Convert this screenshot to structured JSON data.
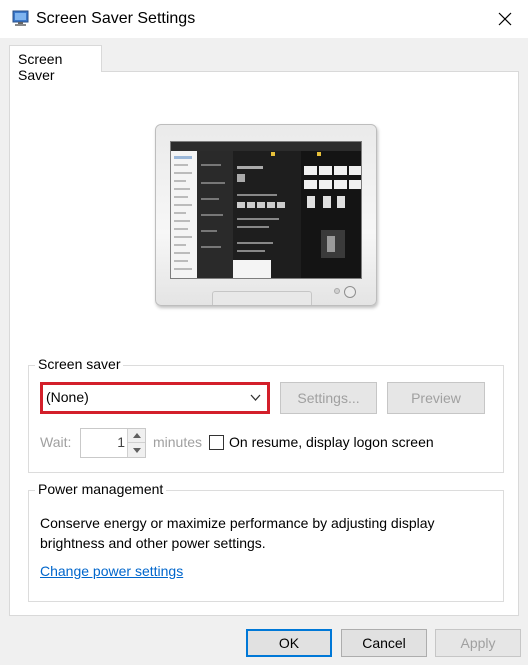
{
  "window": {
    "title": "Screen Saver Settings",
    "close_glyph": "✕",
    "icon": "screen-saver-app-icon"
  },
  "tabs": [
    {
      "label": "Screen Saver",
      "selected": true
    }
  ],
  "preview": {
    "icon": "monitor-preview"
  },
  "screen_saver": {
    "group_label": "Screen saver",
    "selected": "(None)",
    "settings_label": "Settings...",
    "preview_label": "Preview",
    "wait_label": "Wait:",
    "wait_value": "1",
    "minutes_label": "minutes",
    "resume_label": "On resume, display logon screen",
    "resume_checked": false,
    "highlight_color": "#d31f2a"
  },
  "power": {
    "group_label": "Power management",
    "description": "Conserve energy or maximize performance by adjusting display brightness and other power settings.",
    "link_label": "Change power settings",
    "link_color": "#0066cc"
  },
  "footer": {
    "ok_label": "OK",
    "cancel_label": "Cancel",
    "apply_label": "Apply",
    "accent": "#0078d7"
  }
}
